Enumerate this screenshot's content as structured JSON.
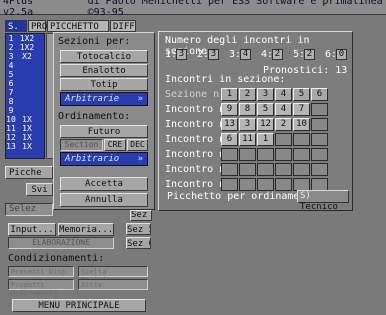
{
  "window": {
    "app_title": "4Plus v2.5a",
    "author": "di Paolo Menichetti per ESS Software e primalinea ©93-95"
  },
  "list_tabs": {
    "sn": "S. N.",
    "pro": "PRO",
    "picchetto": "PICCHETTO",
    "diff": "DIFF"
  },
  "number_strip": [
    [
      "1",
      "1X2"
    ],
    [
      "2",
      "1X2"
    ],
    [
      "3",
      "X2"
    ],
    [
      "4",
      ""
    ],
    [
      "5",
      ""
    ],
    [
      "6",
      ""
    ],
    [
      "7",
      ""
    ],
    [
      "8",
      ""
    ],
    [
      "9",
      ""
    ],
    [
      "10",
      "1X"
    ],
    [
      "11",
      "1X"
    ],
    [
      "12",
      "1X"
    ],
    [
      "13",
      "1X"
    ]
  ],
  "left_side": {
    "picche_label": "Picche",
    "svi_button": "Svi",
    "selez_label": "Selez",
    "input_button": "Input...",
    "memoria_button": "Memoria...",
    "elaborazione": "ELABORAZIONE",
    "sez4": "Sez 4",
    "sez5": "Sez 5",
    "sez6": "Sez 6",
    "condizionamenti": "Condizionamenti:",
    "faded1": "Presenti Disp.",
    "faded2": "Scelta posizione",
    "faded3": "Prodotti ordinamento",
    "faded4": "Attiv",
    "menu_principale": "MENU PRINCIPALE"
  },
  "panel_sezioni": {
    "sezioni_label": "Sezioni per:",
    "totocalcio": "Totocalcio",
    "enalotto": "Enalotto",
    "totip": "Totip",
    "arbitrarie": "Arbitrarie",
    "arbitrarie_arrow": "»",
    "ordinamento_label": "Ordinamento:",
    "futuro": "Futuro",
    "section": "Section",
    "cre": "CRE",
    "dec": "DEC",
    "arbitrario": "Arbitrario",
    "arbitrario_arrow": "»",
    "accetta": "Accetta",
    "annulla": "Annulla"
  },
  "panel_incontri": {
    "numero_label": "Numero degli incontri in sezione:",
    "counts": [
      {
        "label": "1:",
        "value": "3"
      },
      {
        "label": "2:",
        "value": "3"
      },
      {
        "label": "3:",
        "value": "4"
      },
      {
        "label": "4:",
        "value": "2"
      },
      {
        "label": "5:",
        "value": "2"
      },
      {
        "label": "6:",
        "value": "0"
      }
    ],
    "pronostici_label": "Pronostici:",
    "pronostici_value": "13",
    "incontri_label": "Incontri in sezione:",
    "header_label": "Sezione n.",
    "headers": [
      "1",
      "2",
      "3",
      "4",
      "5",
      "6"
    ],
    "rows": [
      {
        "label": "Incontro n.1",
        "cells": [
          "9",
          "8",
          "5",
          "4",
          "7",
          ""
        ]
      },
      {
        "label": "Incontro n.2",
        "cells": [
          "13",
          "3",
          "12",
          "2",
          "10",
          ""
        ]
      },
      {
        "label": "Incontro n.3",
        "cells": [
          "6",
          "11",
          "1",
          "",
          "",
          ""
        ]
      },
      {
        "label": "Incontro n.4",
        "cells": [
          "",
          "",
          "",
          "",
          "",
          ""
        ]
      },
      {
        "label": "Incontro n.5",
        "cells": [
          "",
          "",
          "",
          "",
          "",
          ""
        ]
      },
      {
        "label": "Incontro n.6",
        "cells": [
          "",
          "",
          "",
          "",
          "",
          ""
        ]
      }
    ],
    "picchetto_label": "Picchetto per ordinamento:",
    "picchetto_value": "Tecnico",
    "picchetto_mark": "S)"
  }
}
